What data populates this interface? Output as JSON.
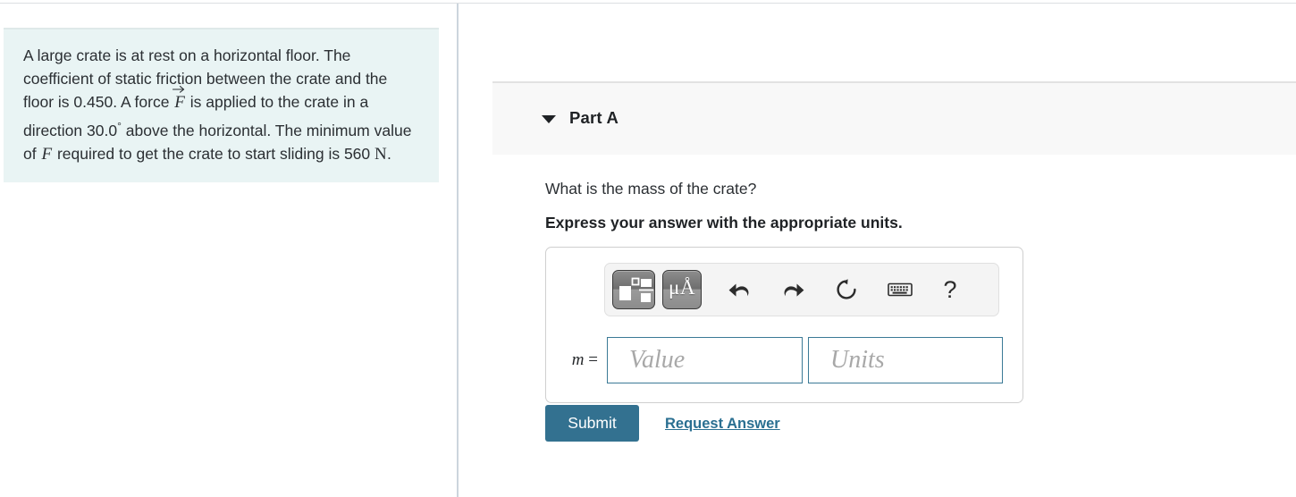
{
  "problem": {
    "segments": [
      {
        "type": "text",
        "value": "A large crate is at rest on a horizontal floor. The coefficient of static friction between the crate and the floor is 0.450. A force "
      },
      {
        "type": "vector-var",
        "value": "F"
      },
      {
        "type": "text",
        "value": " is applied to the crate in a direction 30.0"
      },
      {
        "type": "degree",
        "value": "°"
      },
      {
        "type": "text",
        "value": " above the horizontal. The minimum value of "
      },
      {
        "type": "var",
        "value": "F"
      },
      {
        "type": "text",
        "value": " required to get the crate to start sliding is 560 "
      },
      {
        "type": "unit",
        "value": "N"
      },
      {
        "type": "text",
        "value": "."
      }
    ],
    "full_text": "A large crate is at rest on a horizontal floor. The coefficient of static friction between the crate and the floor is 0.450. A force F is applied to the crate in a direction 30.0° above the horizontal. The minimum value of F required to get the crate to start sliding is 560 N.",
    "force_symbol": "F",
    "force_symbol_plain": "F",
    "coefficient": "0.450",
    "angle": "30.0°",
    "force_value": "560",
    "force_unit": "N",
    "background_color": "#e9f4f4"
  },
  "part": {
    "caret_icon": "chevron-down-icon",
    "title": "Part A",
    "expanded": true,
    "header_background": "#f8f8f8",
    "question": "What is the mass of the crate?",
    "instruction": "Express your answer with the appropriate units."
  },
  "answer": {
    "variable_label": "m",
    "equals": "=",
    "value_placeholder": "Value",
    "units_placeholder": "Units",
    "value_current": "",
    "units_current": "",
    "field_border_color": "#3b7a96",
    "toolbar": {
      "buttons": [
        {
          "name": "math-templates-button",
          "icon": "math-template-icon",
          "label": ""
        },
        {
          "name": "units-symbols-button",
          "icon": "mu-angstrom-icon",
          "label": "μÅ"
        },
        {
          "name": "undo-button",
          "icon": "undo-icon",
          "label": ""
        },
        {
          "name": "redo-button",
          "icon": "redo-icon",
          "label": ""
        },
        {
          "name": "reset-button",
          "icon": "reset-icon",
          "label": ""
        },
        {
          "name": "keyboard-button",
          "icon": "keyboard-icon",
          "label": ""
        },
        {
          "name": "help-button",
          "icon": "question-mark-icon",
          "label": "?"
        }
      ]
    }
  },
  "actions": {
    "submit_label": "Submit",
    "submit_color": "#337190",
    "request_answer_label": "Request Answer",
    "link_color": "#2a6f91"
  }
}
